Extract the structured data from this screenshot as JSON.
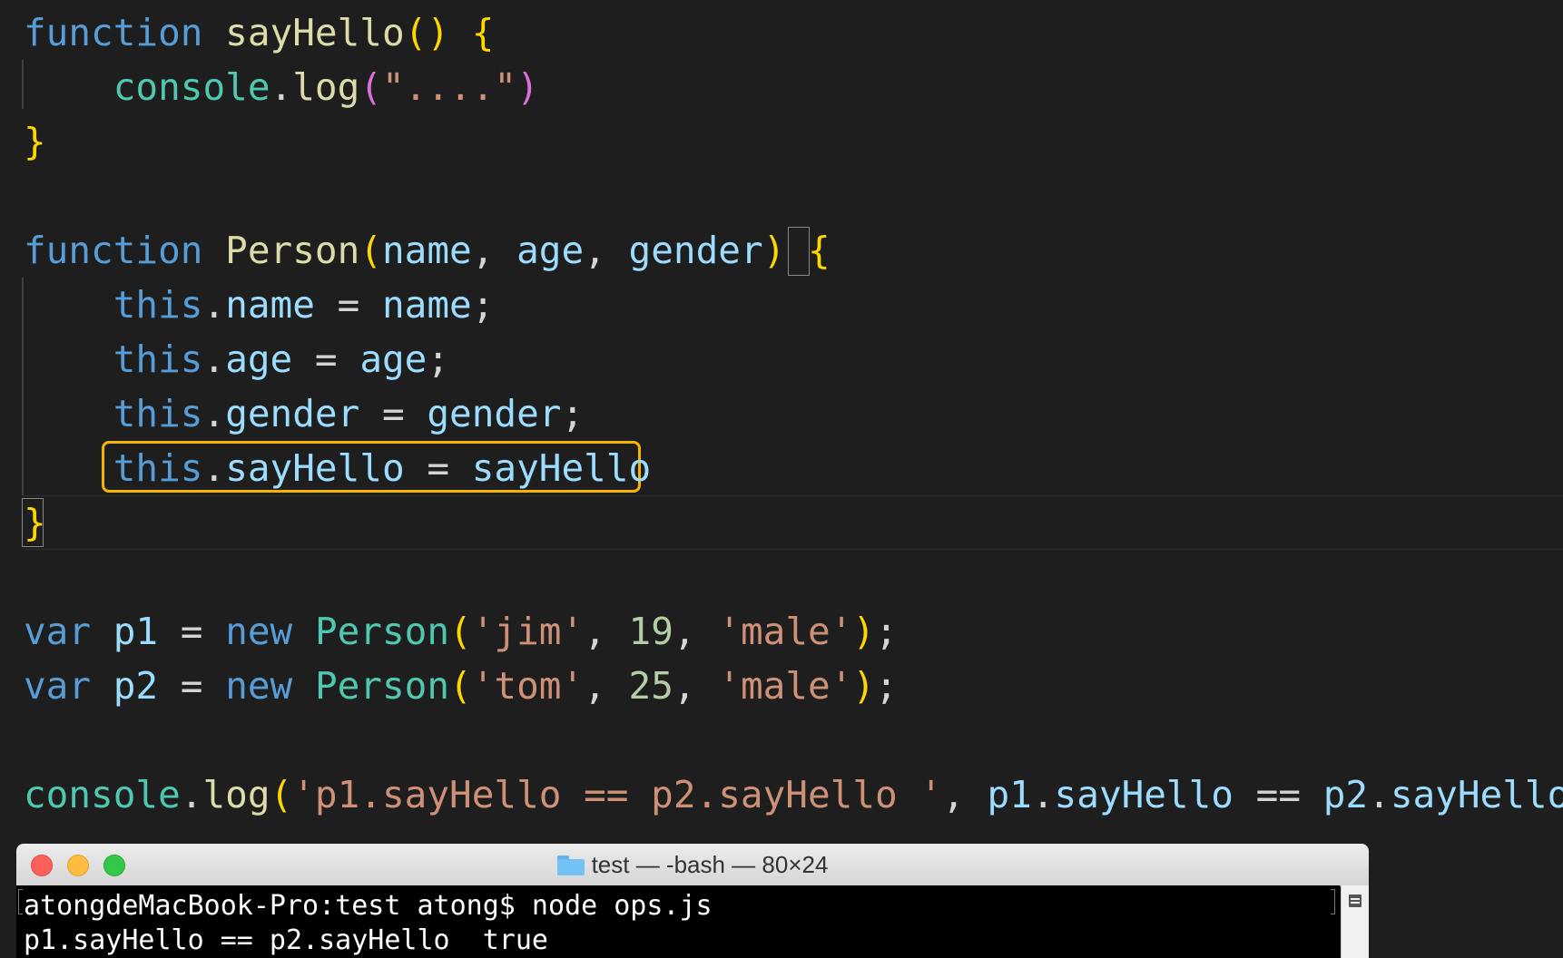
{
  "editor": {
    "lines": [
      [
        [
          "kw",
          "function"
        ],
        [
          "plain",
          " "
        ],
        [
          "fn",
          "sayHello"
        ],
        [
          "br1",
          "()"
        ],
        [
          "plain",
          " "
        ],
        [
          "br1",
          "{"
        ]
      ],
      [
        [
          "plain",
          "    "
        ],
        [
          "cls",
          "console"
        ],
        [
          "plain",
          "."
        ],
        [
          "fn",
          "log"
        ],
        [
          "br2",
          "("
        ],
        [
          "str",
          "\"....\""
        ],
        [
          "br2",
          ")"
        ]
      ],
      [
        [
          "br1",
          "}"
        ]
      ],
      [],
      [
        [
          "kw",
          "function"
        ],
        [
          "plain",
          " "
        ],
        [
          "fn",
          "Person"
        ],
        [
          "br1",
          "("
        ],
        [
          "var",
          "name"
        ],
        [
          "plain",
          ", "
        ],
        [
          "var",
          "age"
        ],
        [
          "plain",
          ", "
        ],
        [
          "var",
          "gender"
        ],
        [
          "br1",
          ")"
        ],
        [
          "plain",
          " "
        ],
        [
          "br1",
          "{"
        ]
      ],
      [
        [
          "plain",
          "    "
        ],
        [
          "this",
          "this"
        ],
        [
          "plain",
          "."
        ],
        [
          "var",
          "name"
        ],
        [
          "plain",
          " = "
        ],
        [
          "var",
          "name"
        ],
        [
          "plain",
          ";"
        ]
      ],
      [
        [
          "plain",
          "    "
        ],
        [
          "this",
          "this"
        ],
        [
          "plain",
          "."
        ],
        [
          "var",
          "age"
        ],
        [
          "plain",
          " = "
        ],
        [
          "var",
          "age"
        ],
        [
          "plain",
          ";"
        ]
      ],
      [
        [
          "plain",
          "    "
        ],
        [
          "this",
          "this"
        ],
        [
          "plain",
          "."
        ],
        [
          "var",
          "gender"
        ],
        [
          "plain",
          " = "
        ],
        [
          "var",
          "gender"
        ],
        [
          "plain",
          ";"
        ]
      ],
      [
        [
          "plain",
          "    "
        ],
        [
          "this",
          "this"
        ],
        [
          "plain",
          "."
        ],
        [
          "var",
          "sayHello"
        ],
        [
          "plain",
          " = "
        ],
        [
          "var",
          "sayHello"
        ]
      ],
      [
        [
          "br1",
          "}"
        ]
      ],
      [],
      [
        [
          "kw",
          "var"
        ],
        [
          "plain",
          " "
        ],
        [
          "var",
          "p1"
        ],
        [
          "plain",
          " = "
        ],
        [
          "kw",
          "new"
        ],
        [
          "plain",
          " "
        ],
        [
          "cls",
          "Person"
        ],
        [
          "br1",
          "("
        ],
        [
          "str",
          "'jim'"
        ],
        [
          "plain",
          ", "
        ],
        [
          "num",
          "19"
        ],
        [
          "plain",
          ", "
        ],
        [
          "str",
          "'male'"
        ],
        [
          "br1",
          ")"
        ],
        [
          "plain",
          ";"
        ]
      ],
      [
        [
          "kw",
          "var"
        ],
        [
          "plain",
          " "
        ],
        [
          "var",
          "p2"
        ],
        [
          "plain",
          " = "
        ],
        [
          "kw",
          "new"
        ],
        [
          "plain",
          " "
        ],
        [
          "cls",
          "Person"
        ],
        [
          "br1",
          "("
        ],
        [
          "str",
          "'tom'"
        ],
        [
          "plain",
          ", "
        ],
        [
          "num",
          "25"
        ],
        [
          "plain",
          ", "
        ],
        [
          "str",
          "'male'"
        ],
        [
          "br1",
          ")"
        ],
        [
          "plain",
          ";"
        ]
      ],
      [],
      [
        [
          "cls",
          "console"
        ],
        [
          "plain",
          "."
        ],
        [
          "fn",
          "log"
        ],
        [
          "br1",
          "("
        ],
        [
          "str",
          "'p1.sayHello == p2.sayHello '"
        ],
        [
          "plain",
          ", "
        ],
        [
          "var",
          "p1"
        ],
        [
          "plain",
          "."
        ],
        [
          "var",
          "sayHello"
        ],
        [
          "plain",
          " == "
        ],
        [
          "var",
          "p2"
        ],
        [
          "plain",
          "."
        ],
        [
          "var",
          "sayHello"
        ],
        [
          "br1",
          ")"
        ]
      ]
    ]
  },
  "terminal": {
    "title": "test — -bash — 80×24",
    "folder_icon": "folder-icon",
    "lines": [
      "atongdeMacBook-Pro:test atong$ node ops.js",
      "p1.sayHello == p2.sayHello  true"
    ]
  },
  "colors": {
    "highlight_box": "#f4b400",
    "keyword": "#569cd6",
    "function": "#dcdcaa",
    "class": "#4ec9b0",
    "variable": "#9cdcfe",
    "string": "#ce9178",
    "number": "#b5cea8",
    "bracket_gold": "#ffd700",
    "bracket_purple": "#da70d6"
  }
}
